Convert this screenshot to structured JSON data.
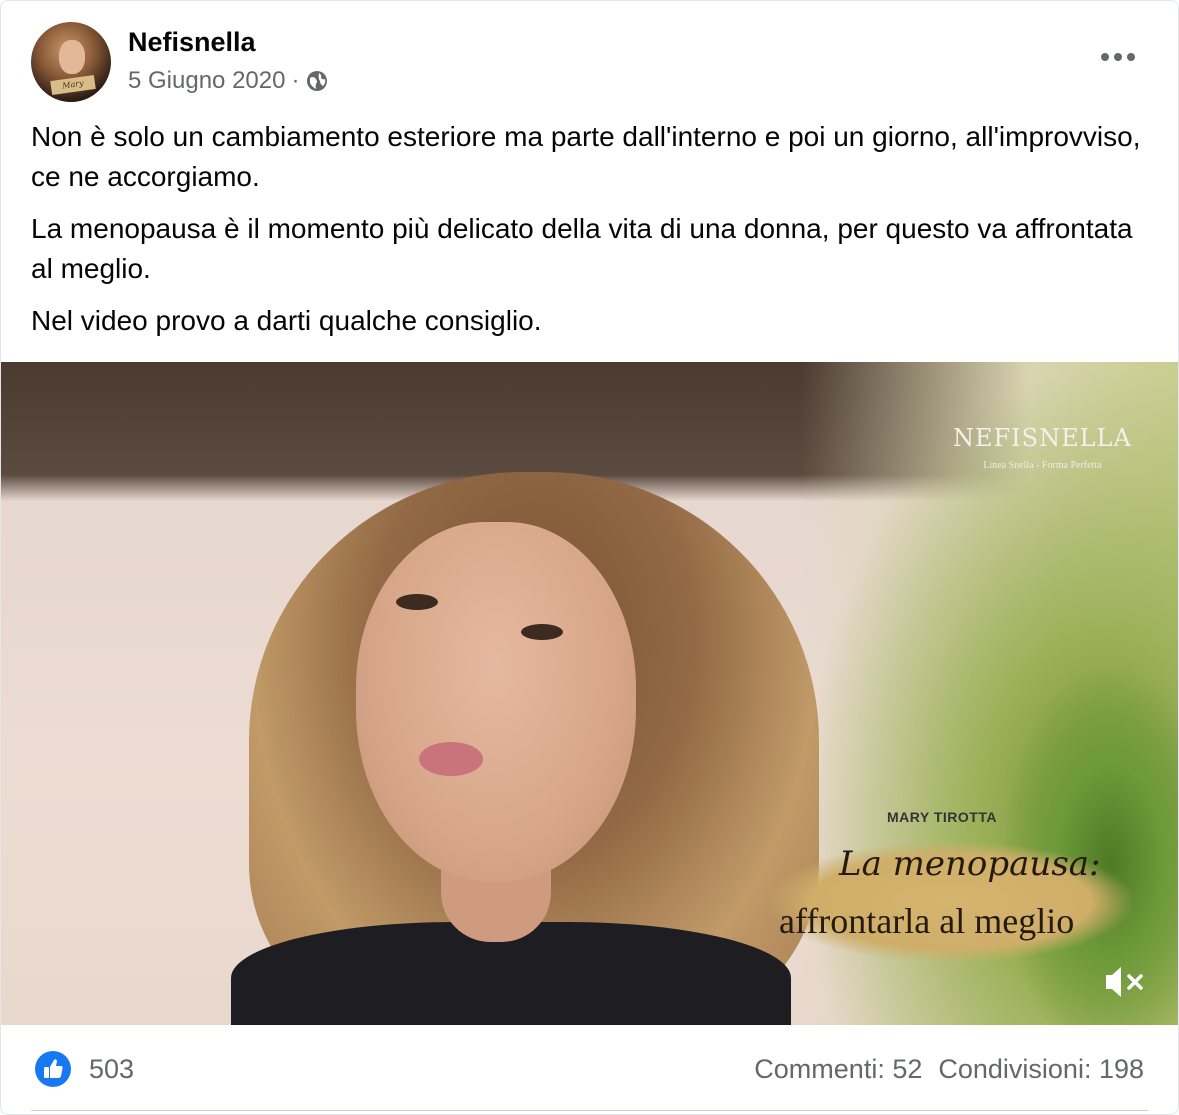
{
  "post": {
    "page_name": "Nefisnella",
    "date": "5 Giugno 2020",
    "separator": "·",
    "audience_icon": "globe-icon",
    "more_icon": "more-options-icon",
    "avatar_sign": "Mary",
    "paragraphs": [
      "Non è solo un cambiamento esteriore ma parte dall'interno e poi un giorno, all'improvviso, ce ne accorgiamo.",
      "La menopausa è il momento più delicato della vita di una donna, per questo va affrontata al meglio.",
      "Nel video provo a darti qualche consiglio."
    ]
  },
  "video": {
    "brand_name": "NEFISNELLA",
    "brand_tagline": "Linea Snella - Forma Perfetta",
    "presenter": "MARY TIROTTA",
    "title_line1": "La menopausa:",
    "title_line2": "affrontarla al meglio",
    "mute_icon": "volume-muted-icon"
  },
  "footer": {
    "like_icon": "like-icon",
    "likes": "503",
    "comments": "Commenti: 52",
    "shares": "Condivisioni: 198"
  },
  "colors": {
    "primary_text": "#050505",
    "secondary_text": "#65676b",
    "like_blue": "#1877f2",
    "divider": "#ced0d4"
  }
}
